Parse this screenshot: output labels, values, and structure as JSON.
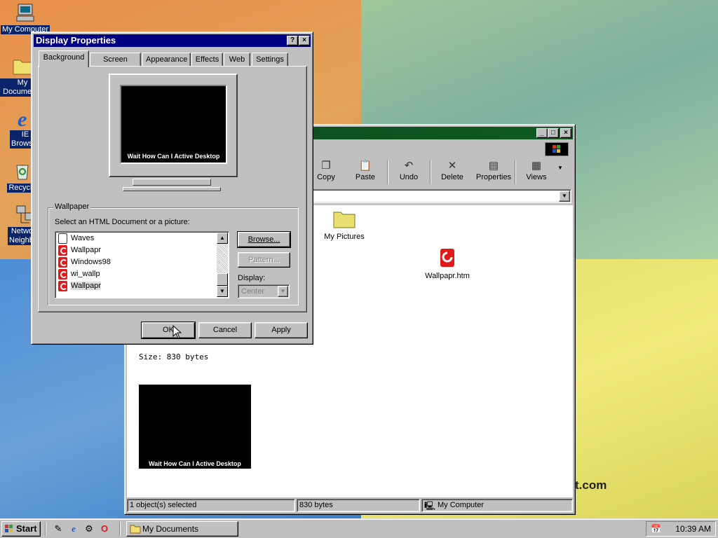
{
  "desktop": {
    "icons": [
      {
        "label": "My Computer"
      },
      {
        "label": "My Documents"
      },
      {
        "label": "IE Browser"
      },
      {
        "label": "Recycle"
      },
      {
        "label": "Network Neighborhood"
      }
    ],
    "wallpaper_text": "t.com"
  },
  "explorer": {
    "toolbar": [
      "Copy",
      "Paste",
      "Undo",
      "Delete",
      "Properties",
      "Views"
    ],
    "folder_label": "My Pictures",
    "file_label": "Wallpapr.htm",
    "size_text": "Size: 830 bytes",
    "preview_text": "Wait How Can I Active Desktop",
    "status": {
      "selected": "1 object(s) selected",
      "size": "830 bytes",
      "zone": "My Computer"
    }
  },
  "dialog": {
    "title": "Display Properties",
    "tabs": [
      "Background",
      "Screen Saver",
      "Appearance",
      "Effects",
      "Web",
      "Settings"
    ],
    "preview_text": "Wait How Can I Active Desktop",
    "group_label": "Wallpaper",
    "list_prompt": "Select an HTML Document or a picture:",
    "items": [
      "Waves",
      "Wallpapr",
      "Windows98",
      "wi_wallp",
      "Wallpapr"
    ],
    "browse": "Browse...",
    "pattern": "Pattern...",
    "display_label": "Display:",
    "display_value": "Center",
    "ok": "OK",
    "cancel": "Cancel",
    "apply": "Apply"
  },
  "taskbar": {
    "start": "Start",
    "task": "My Documents",
    "clock": "10:39 AM"
  }
}
